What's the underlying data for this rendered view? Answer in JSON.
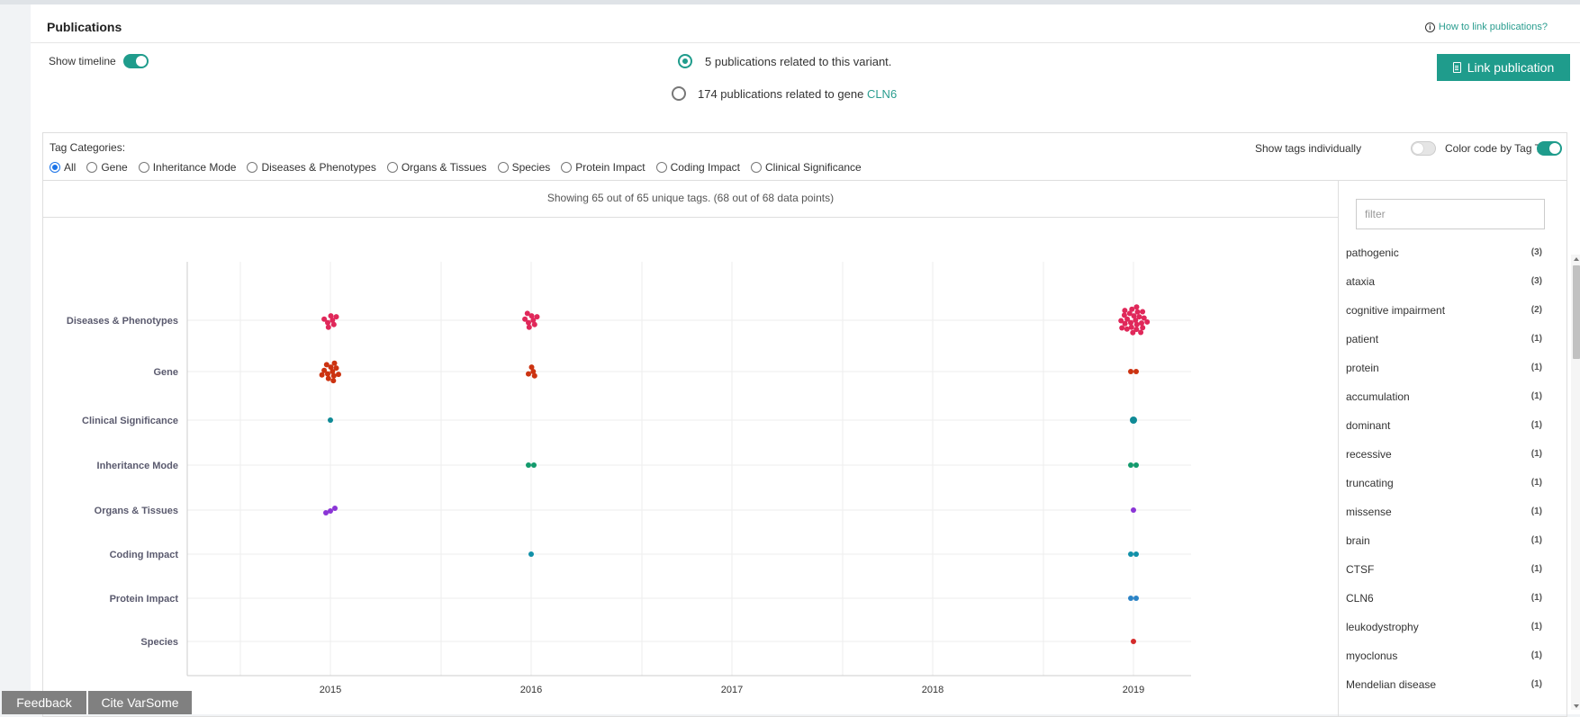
{
  "header": {
    "title": "Publications",
    "help_link": "How to link publications?"
  },
  "controls": {
    "show_timeline_label": "Show timeline",
    "option_variant": "5 publications related to this variant.",
    "option_gene_prefix": "174 publications related to gene",
    "option_gene_name": "CLN6",
    "link_button": "Link publication"
  },
  "tags": {
    "categories_label": "Tag Categories:",
    "categories": [
      "All",
      "Gene",
      "Inheritance Mode",
      "Diseases & Phenotypes",
      "Organs & Tissues",
      "Species",
      "Protein Impact",
      "Coding Impact",
      "Clinical Significance"
    ],
    "selected_category": "All",
    "show_individually_label": "Show tags individually",
    "color_code_label": "Color code by Tag Type"
  },
  "summary": "Showing 65 out of 65 unique tags. (68 out of 68 data points)",
  "filter": {
    "placeholder": "filter"
  },
  "tag_list": [
    {
      "name": "pathogenic",
      "count": "(3)"
    },
    {
      "name": "ataxia",
      "count": "(3)"
    },
    {
      "name": "cognitive impairment",
      "count": "(2)"
    },
    {
      "name": "patient",
      "count": "(1)"
    },
    {
      "name": "protein",
      "count": "(1)"
    },
    {
      "name": "accumulation",
      "count": "(1)"
    },
    {
      "name": "dominant",
      "count": "(1)"
    },
    {
      "name": "recessive",
      "count": "(1)"
    },
    {
      "name": "truncating",
      "count": "(1)"
    },
    {
      "name": "missense",
      "count": "(1)"
    },
    {
      "name": "brain",
      "count": "(1)"
    },
    {
      "name": "CTSF",
      "count": "(1)"
    },
    {
      "name": "CLN6",
      "count": "(1)"
    },
    {
      "name": "leukodystrophy",
      "count": "(1)"
    },
    {
      "name": "myoclonus",
      "count": "(1)"
    },
    {
      "name": "Mendelian disease",
      "count": "(1)"
    }
  ],
  "chart_data": {
    "type": "scatter",
    "x_ticks": [
      "2015",
      "2016",
      "2017",
      "2018",
      "2019"
    ],
    "categories": [
      "Diseases & Phenotypes",
      "Gene",
      "Clinical Significance",
      "Inheritance Mode",
      "Organs & Tissues",
      "Coding Impact",
      "Protein Impact",
      "Species"
    ],
    "colors": {
      "Diseases & Phenotypes": "#e0285a",
      "Gene": "#cc3311",
      "Clinical Significance": "#0f8a96",
      "Inheritance Mode": "#129a6c",
      "Organs & Tissues": "#8b35d6",
      "Coding Impact": "#1190a8",
      "Protein Impact": "#2b83c6",
      "Species": "#d42a2a"
    },
    "series": [
      {
        "name": "Diseases & Phenotypes",
        "points": [
          {
            "x": "2015",
            "count": 7
          },
          {
            "x": "2016",
            "count": 8
          },
          {
            "x": "2019",
            "count": 25
          }
        ]
      },
      {
        "name": "Gene",
        "points": [
          {
            "x": "2015",
            "count": 12
          },
          {
            "x": "2016",
            "count": 4
          },
          {
            "x": "2019",
            "count": 2
          }
        ]
      },
      {
        "name": "Clinical Significance",
        "points": [
          {
            "x": "2015",
            "count": 1
          },
          {
            "x": "2019",
            "count": 1
          }
        ]
      },
      {
        "name": "Inheritance Mode",
        "points": [
          {
            "x": "2016",
            "count": 2
          },
          {
            "x": "2019",
            "count": 2
          }
        ]
      },
      {
        "name": "Organs & Tissues",
        "points": [
          {
            "x": "2015",
            "count": 3
          },
          {
            "x": "2019",
            "count": 1
          }
        ]
      },
      {
        "name": "Coding Impact",
        "points": [
          {
            "x": "2016",
            "count": 1
          },
          {
            "x": "2019",
            "count": 2
          }
        ]
      },
      {
        "name": "Protein Impact",
        "points": [
          {
            "x": "2019",
            "count": 2
          }
        ]
      },
      {
        "name": "Species",
        "points": [
          {
            "x": "2019",
            "count": 1
          }
        ]
      }
    ]
  },
  "footer": {
    "feedback": "Feedback",
    "cite": "Cite VarSome"
  }
}
